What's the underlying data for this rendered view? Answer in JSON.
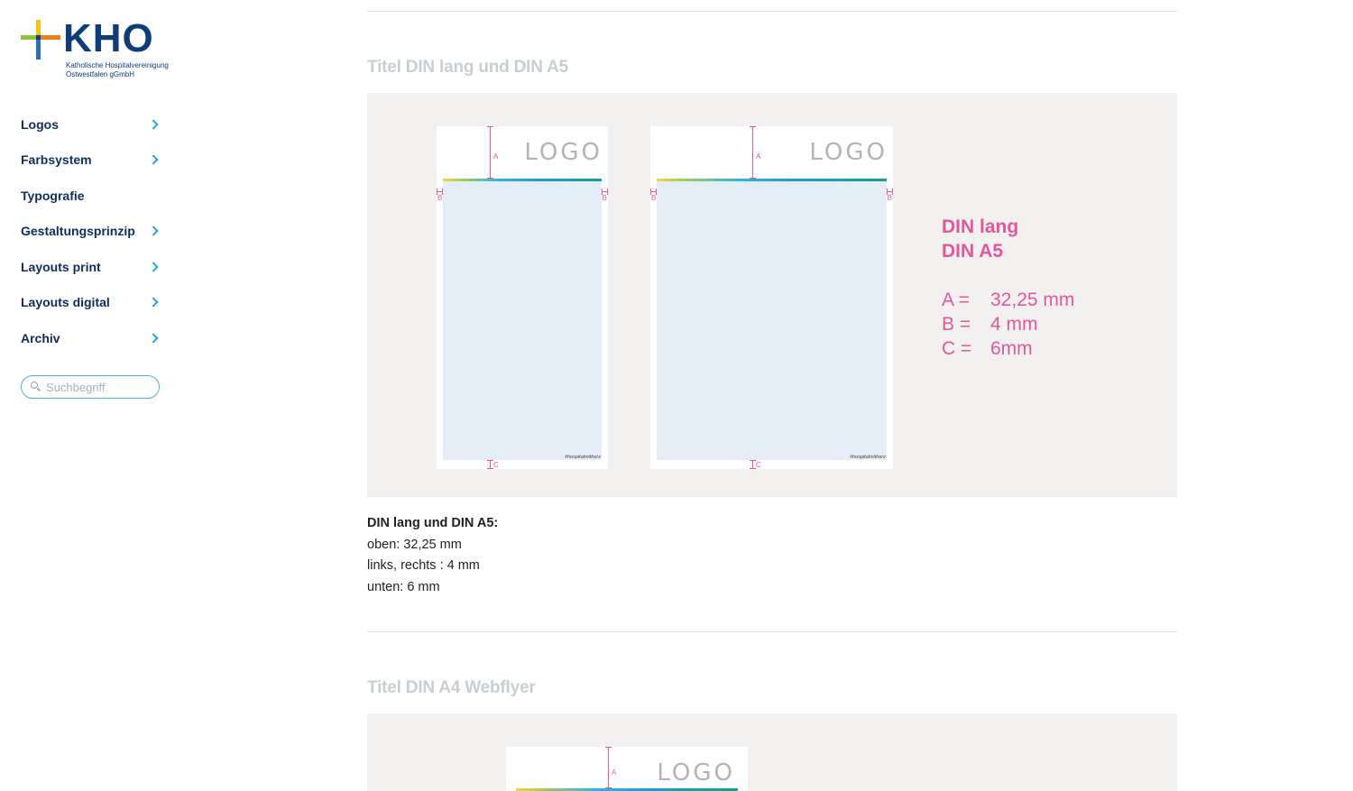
{
  "brand": {
    "wordmark": "KHO",
    "subtitle_line1": "Katholische Hospitalvereinigung",
    "subtitle_line2": "Ostwestfalen gGmbH",
    "colors": {
      "navy": "#0f3d7a",
      "accent": "#2aa3d6",
      "pink": "#e2579a"
    }
  },
  "sidebar": {
    "items": [
      {
        "label": "Logos",
        "has_submenu": true
      },
      {
        "label": "Farbsystem",
        "has_submenu": true
      },
      {
        "label": "Typografie",
        "has_submenu": false
      },
      {
        "label": "Gestaltungsprinzip",
        "has_submenu": true
      },
      {
        "label": "Layouts print",
        "has_submenu": true
      },
      {
        "label": "Layouts digital",
        "has_submenu": true
      },
      {
        "label": "Archiv",
        "has_submenu": true
      }
    ],
    "search": {
      "placeholder": "Suchbegriff",
      "value": ""
    }
  },
  "section1": {
    "title": "Titel DIN lang und DIN A5",
    "mockups": {
      "logo_text": "LOGO",
      "tag": "#hospitalmitherz",
      "label_a": "A",
      "label_b": "B",
      "label_c": "C"
    },
    "spec": {
      "heading_line1": "DIN lang",
      "heading_line2": "DIN A5",
      "rows": [
        {
          "key": "A =",
          "value": "32,25 mm"
        },
        {
          "key": "B =",
          "value": "4 mm"
        },
        {
          "key": "C =",
          "value": "6mm"
        }
      ]
    },
    "description": {
      "title": "DIN lang und DIN A5:",
      "lines": [
        "oben: 32,25 mm",
        "links, rechts : 4 mm",
        "unten: 6 mm"
      ]
    }
  },
  "section2": {
    "title": "Titel DIN A4 Webflyer",
    "mockup": {
      "logo_text": "LOGO",
      "label_a": "A"
    }
  }
}
